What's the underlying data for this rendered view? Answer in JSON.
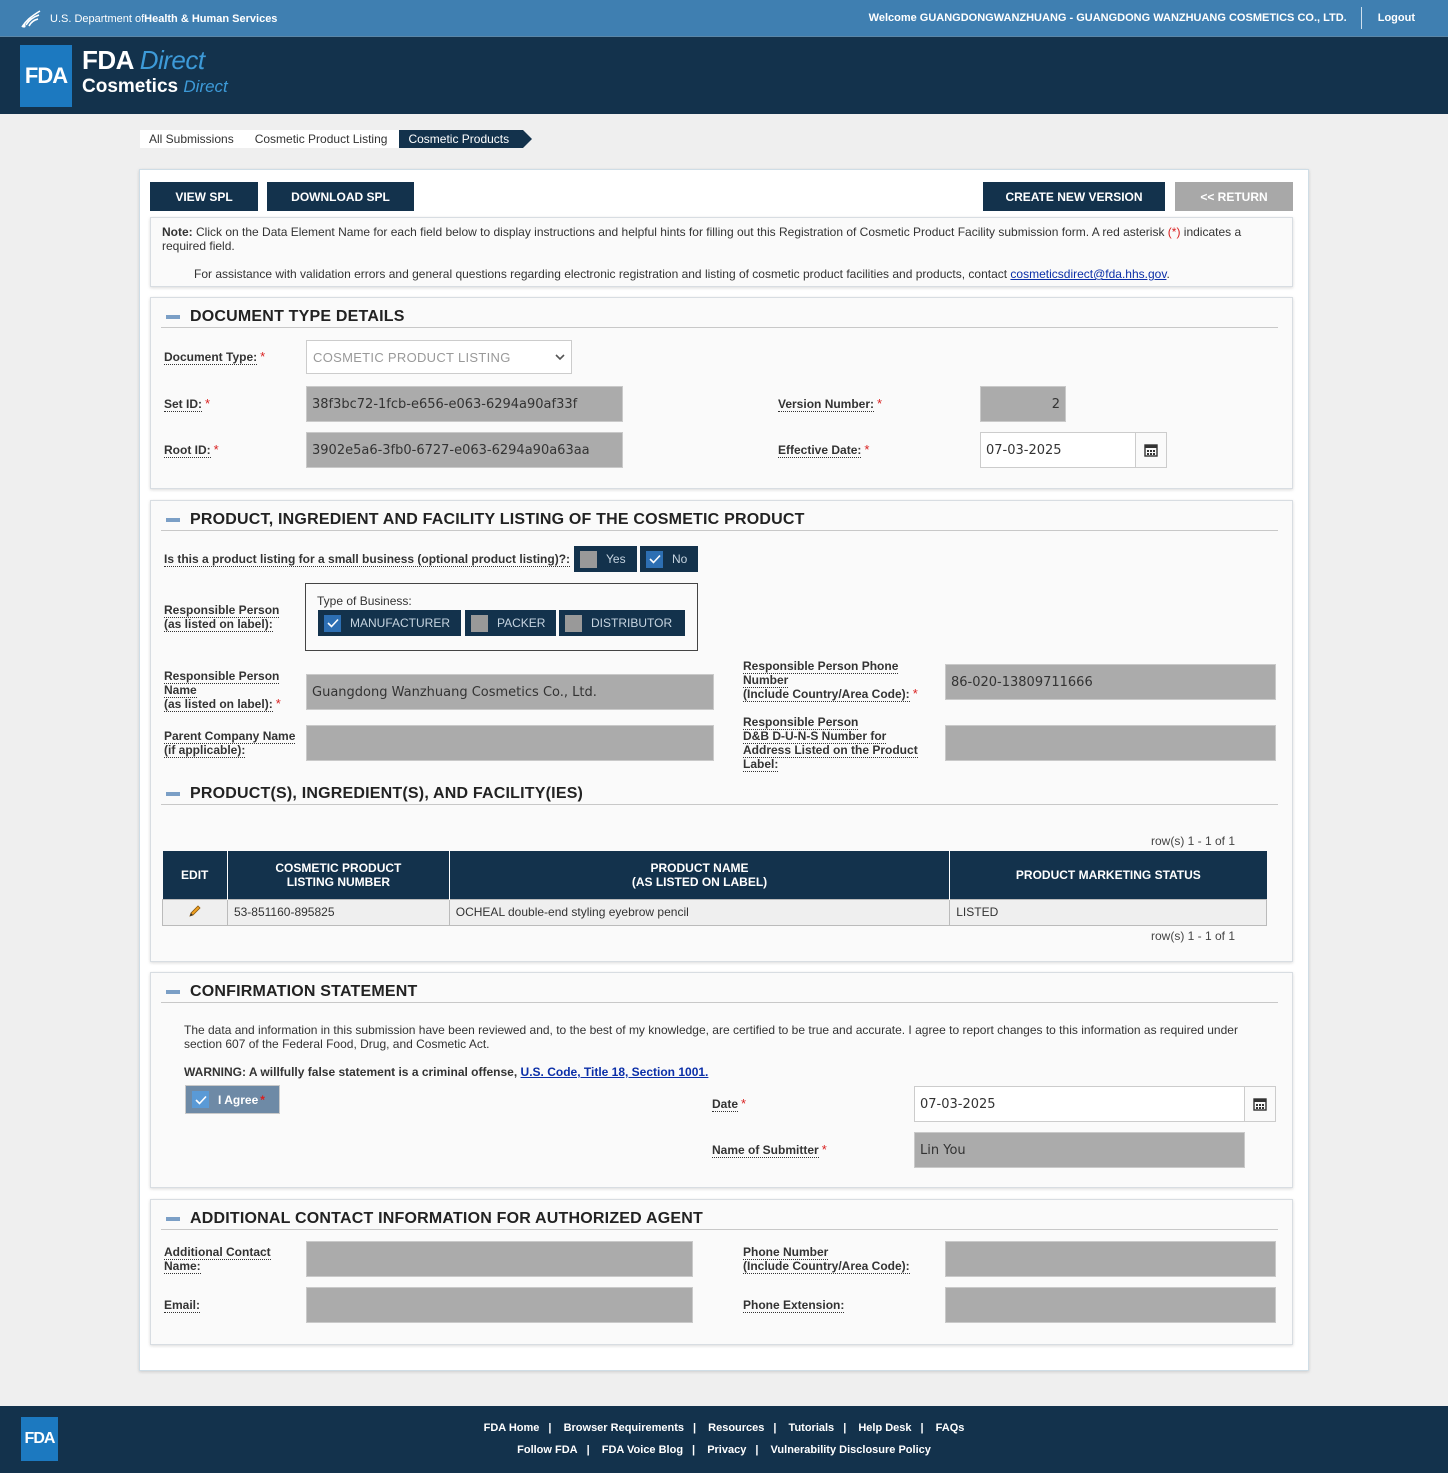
{
  "hhs": {
    "dept_prefix": "U.S. Department of ",
    "dept_bold": "Health & Human Services",
    "welcome": "Welcome GUANGDONGWANZHUANG - GUANGDONG WANZHUANG COSMETICS CO., LTD.",
    "logout": "Logout"
  },
  "brand": {
    "logo": "FDA",
    "line1_bold": "FDA",
    "line1_italic": "Direct",
    "line2_bold": "Cosmetics",
    "line2_italic": "Direct"
  },
  "breadcrumb": [
    "All Submissions",
    "Cosmetic Product Listing",
    "Cosmetic Products"
  ],
  "toolbar": {
    "view_spl": "VIEW SPL",
    "download_spl": "DOWNLOAD SPL",
    "create_new_version": "CREATE NEW VERSION",
    "return": "<< RETURN"
  },
  "note": {
    "label": "Note:",
    "text1": " Click on the Data Element Name for each field below to display instructions and helpful hints for filling out this Registration of Cosmetic Product Facility submission form. A red asterisk ",
    "asterisk": "(*)",
    "text2": " indicates a required field.",
    "assist": "For assistance with validation errors and general questions regarding electronic registration and listing of cosmetic product facilities and products, contact ",
    "email": "cosmeticsdirect@fda.hhs.gov",
    "period": "."
  },
  "document": {
    "title": "DOCUMENT TYPE DETAILS",
    "doc_type_label": "Document Type:",
    "doc_type_value": "COSMETIC PRODUCT LISTING",
    "set_id_label": "Set ID:",
    "set_id_value": "38f3bc72-1fcb-e656-e063-6294a90af33f",
    "root_id_label": "Root ID:",
    "root_id_value": "3902e5a6-3fb0-6727-e063-6294a90a63aa",
    "version_label": "Version Number:",
    "version_value": "2",
    "effective_label": "Effective Date:",
    "effective_value": "07-03-2025"
  },
  "product": {
    "title": "PRODUCT, INGREDIENT AND FACILITY LISTING OF THE COSMETIC PRODUCT",
    "small_business_label": "Is this a product listing for a small business (optional product listing)?:",
    "yes": "Yes",
    "no": "No",
    "resp_person_label1": "Responsible Person",
    "resp_person_label2": "(as listed on label):",
    "type_of_business": "Type of Business:",
    "manufacturer": "MANUFACTURER",
    "packer": "PACKER",
    "distributor": "DISTRIBUTOR",
    "resp_name_label1": "Responsible Person",
    "resp_name_label2": "Name",
    "resp_name_label3": "(as listed on label):",
    "resp_name_value": "Guangdong Wanzhuang Cosmetics Co., Ltd.",
    "phone_label1": "Responsible Person Phone",
    "phone_label2": "Number",
    "phone_label3": "(Include Country/Area Code):",
    "phone_value": "86-020-13809711666",
    "parent_label1": "Parent Company Name",
    "parent_label2": "(if applicable):",
    "parent_value": "",
    "duns_label1": "Responsible Person",
    "duns_label2": "D&B D-U-N-S Number for",
    "duns_label3": "Address Listed on the Product",
    "duns_label4": "Label:",
    "duns_value": ""
  },
  "listing": {
    "title": "PRODUCT(S), INGREDIENT(S), AND FACILITY(IES)",
    "rows_top": "row(s) 1 - 1 of 1",
    "rows_bottom": "row(s) 1 - 1 of 1",
    "headers": {
      "edit": "EDIT",
      "listing_1": "COSMETIC PRODUCT",
      "listing_2": "LISTING NUMBER",
      "name_1": "PRODUCT NAME",
      "name_2": "(AS LISTED ON LABEL)",
      "status": "PRODUCT MARKETING STATUS"
    },
    "rows": [
      {
        "listing_number": "53-851160-895825",
        "product_name": "OCHEAL double-end styling eyebrow pencil",
        "status": "LISTED"
      }
    ]
  },
  "confirmation": {
    "title": "CONFIRMATION STATEMENT",
    "statement": "The data and information in this submission have been reviewed and, to the best of my knowledge, are certified to be true and accurate. I agree to report changes to this information as required under section 607 of the Federal Food, Drug, and Cosmetic Act.",
    "warning": "WARNING: A willfully false statement is a criminal offense, ",
    "warning_link": "U.S. Code, Title 18, Section 1001.",
    "agree": "I Agree",
    "date_label": "Date",
    "date_value": "07-03-2025",
    "submitter_label": "Name of Submitter",
    "submitter_value": "Lin You"
  },
  "agent": {
    "title": "ADDITIONAL CONTACT INFORMATION FOR AUTHORIZED AGENT",
    "contact_label1": "Additional Contact",
    "contact_label2": "Name:",
    "email_label": "Email:",
    "phone_label1": "Phone Number",
    "phone_label2": "(Include Country/Area Code):",
    "ext_label": "Phone Extension:"
  },
  "footer": {
    "logo": "FDA",
    "row1": [
      "FDA Home",
      "Browser Requirements",
      "Resources",
      "Tutorials",
      "Help Desk",
      "FAQs"
    ],
    "row2": [
      "Follow FDA",
      "FDA Voice Blog",
      "Privacy",
      "Vulnerability Disclosure Policy"
    ]
  },
  "colors": {
    "hhs_bar": "#3f7fb1",
    "navy": "#13324c",
    "accent_blue": "#1c79c0",
    "required_red": "#d92020",
    "readonly_gray": "#ababab"
  }
}
